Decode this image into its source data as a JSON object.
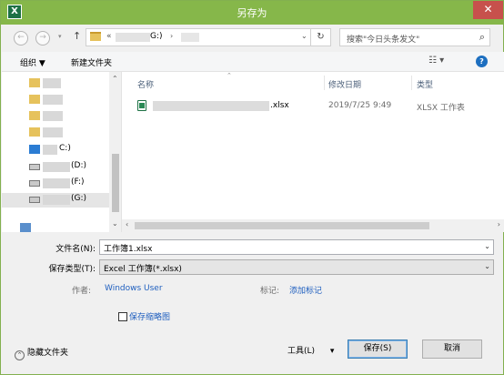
{
  "window": {
    "title": "另存为",
    "app_icon": "X"
  },
  "nav": {
    "back": "←",
    "forward": "→",
    "recent": "▾",
    "up": "↑",
    "address_prefix": "«",
    "address_drive": "G:)",
    "address_sep": "›",
    "address_dropdown": "⌄",
    "refresh": "↻",
    "search_placeholder": "搜索\"今日头条发文\"",
    "search_icon": "⌕"
  },
  "toolbar": {
    "organize": "组织 ▼",
    "new_folder": "新建文件夹",
    "view": "☷ ▾",
    "help": "?"
  },
  "sidebar": {
    "items": [
      {
        "label": ""
      },
      {
        "label": ""
      },
      {
        "label": ""
      },
      {
        "label": ""
      },
      {
        "label": "C:)"
      },
      {
        "label": "(D:)"
      },
      {
        "label": "(F:)"
      },
      {
        "label": "(G:)"
      },
      {
        "label": ""
      }
    ]
  },
  "files": {
    "columns": {
      "name": "名称",
      "date": "修改日期",
      "type": "类型"
    },
    "rows": [
      {
        "name_suffix": ".xlsx",
        "date": "2019/7/25 9:49",
        "type": "XLSX 工作表"
      }
    ]
  },
  "form": {
    "filename_label": "文件名(N):",
    "filename_value": "工作簿1.xlsx",
    "filetype_label": "保存类型(T):",
    "filetype_value": "Excel 工作簿(*.xlsx)",
    "author_label": "作者:",
    "author_value": "Windows User",
    "tags_label": "标记:",
    "tags_value": "添加标记",
    "thumbnail_label": "保存缩略图"
  },
  "footer": {
    "hide_folders": "隐藏文件夹",
    "tools": "工具(L)",
    "tools_arrow": "▾",
    "save": "保存(S)",
    "cancel": "取消"
  },
  "colors": {
    "titlebar": "#86b74a",
    "close": "#c7514c",
    "link": "#1f5fbf"
  }
}
